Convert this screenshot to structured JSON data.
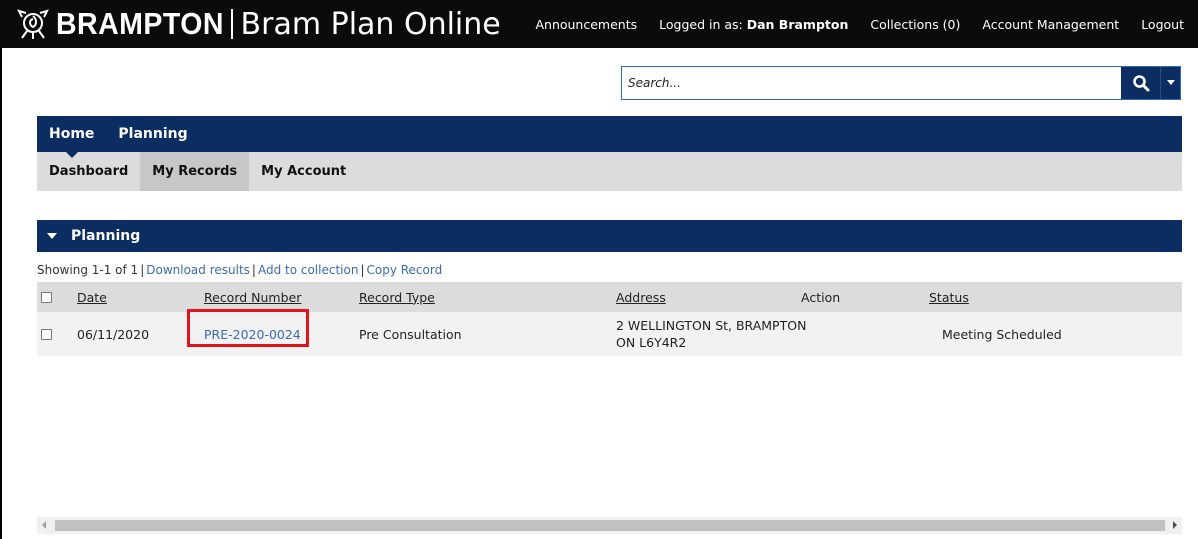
{
  "header": {
    "brand_name": "BRAMPTON",
    "app_name": "Bram Plan Online",
    "links": {
      "announcements": "Announcements",
      "logged_in_label": "Logged in as:",
      "user_name": "Dan Brampton",
      "collections": "Collections (0)",
      "account_management": "Account Management",
      "logout": "Logout"
    }
  },
  "search": {
    "placeholder": "Search..."
  },
  "main_nav": {
    "tabs": [
      {
        "label": "Home"
      },
      {
        "label": "Planning"
      }
    ]
  },
  "sub_nav": {
    "tabs": [
      {
        "label": "Dashboard"
      },
      {
        "label": "My Records"
      },
      {
        "label": "My Account"
      }
    ]
  },
  "section": {
    "title": "Planning"
  },
  "results": {
    "showing": "Showing 1-1 of 1",
    "download": "Download results",
    "add_collection": "Add to collection",
    "copy_record": "Copy Record"
  },
  "table": {
    "headers": {
      "date": "Date",
      "record_number": "Record Number",
      "record_type": "Record Type",
      "address": "Address",
      "action": "Action",
      "status": "Status"
    },
    "rows": [
      {
        "date": "06/11/2020",
        "record_number": "PRE-2020-0024",
        "record_type": "Pre Consultation",
        "address_line1": "2 WELLINGTON St, BRAMPTON",
        "address_line2": "ON L6Y4R2",
        "action": "",
        "status": "Meeting Scheduled"
      }
    ]
  },
  "colors": {
    "navy": "#0c2d62",
    "link": "#3a6bb5",
    "highlight": "#e2141b",
    "topbar": "#0b0b0b"
  }
}
